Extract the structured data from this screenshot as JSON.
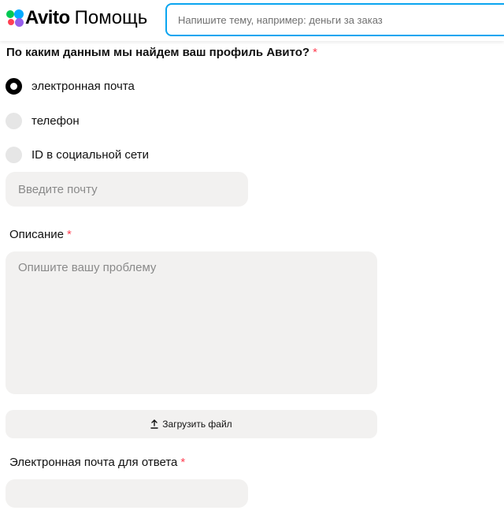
{
  "header": {
    "logo": {
      "brand": "Avito",
      "section": "Помощь",
      "dot_colors": [
        "#00c853",
        "#00aaff",
        "#ff4053",
        "#965eeb"
      ]
    },
    "search": {
      "placeholder": "Напишите тему, например: деньги за заказ",
      "value": "",
      "border_color": "#0aa5f0"
    }
  },
  "form": {
    "profile_question": {
      "label": "По каким данным мы найдем ваш профиль Авито?",
      "required_mark": "*",
      "options": [
        {
          "label": "электронная почта",
          "selected": true
        },
        {
          "label": "телефон",
          "selected": false
        },
        {
          "label": "ID в социальной сети",
          "selected": false
        }
      ],
      "email_input": {
        "placeholder": "Введите почту",
        "value": ""
      }
    },
    "description": {
      "label": "Описание",
      "required_mark": "*",
      "placeholder": "Опишите вашу проблему",
      "value": ""
    },
    "upload": {
      "label": "Загрузить файл",
      "icon": "upload-icon"
    },
    "reply_email": {
      "label": "Электронная почта для ответа",
      "required_mark": "*",
      "value": ""
    }
  },
  "colors": {
    "required": "#ff4053",
    "field_background": "#f2f1f0",
    "radio_unchecked": "#e6e6e6",
    "radio_checked": "#000000"
  }
}
